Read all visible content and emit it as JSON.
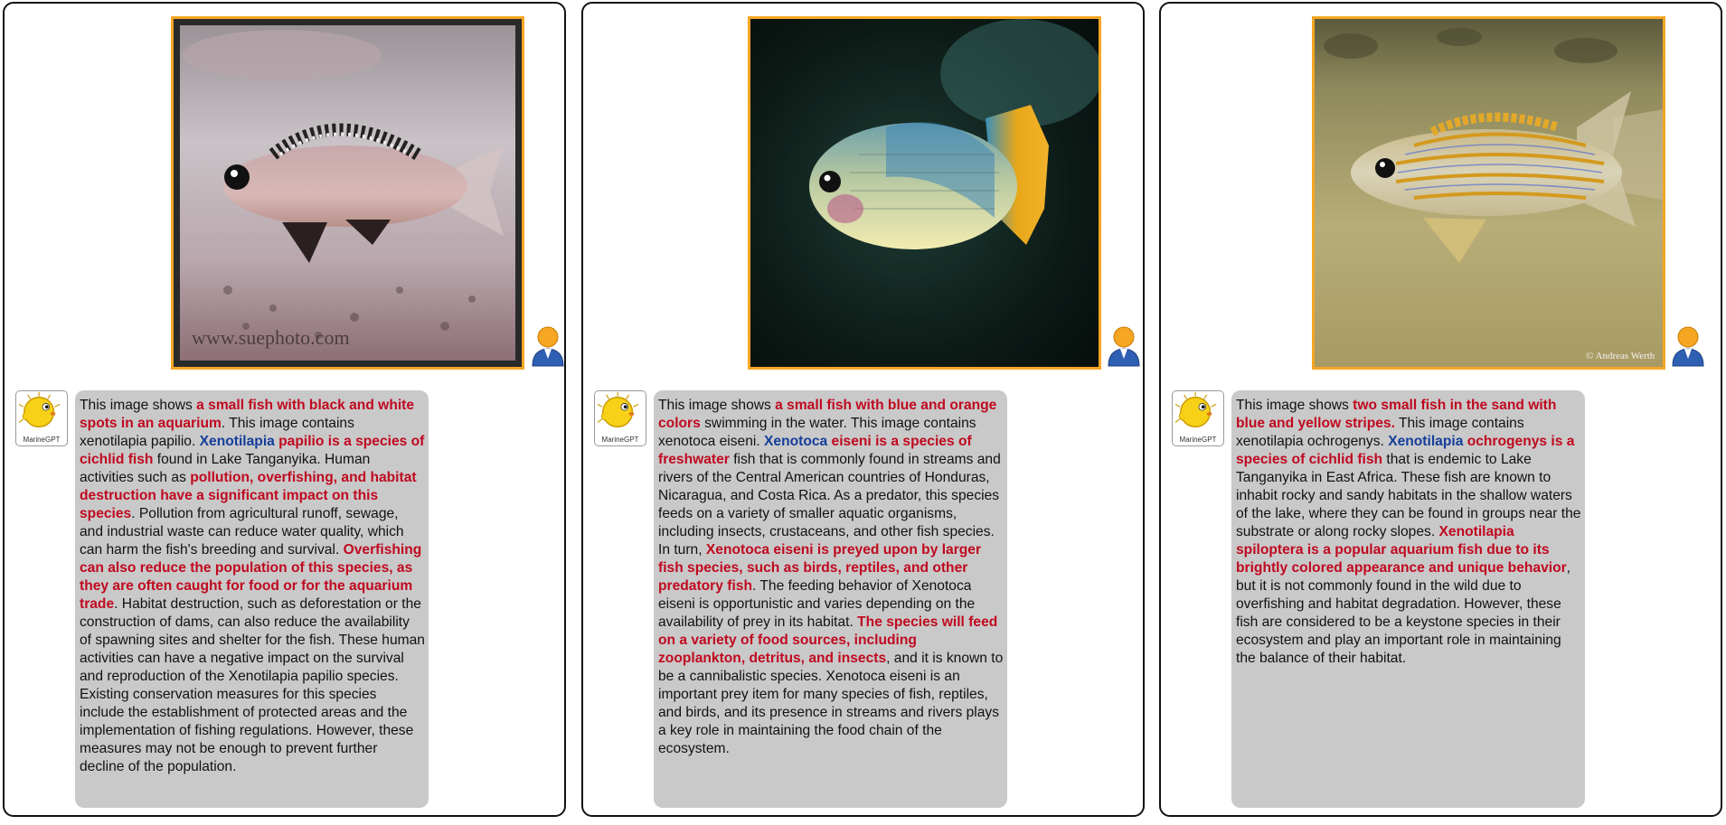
{
  "bot_label": "MarineGPT",
  "colors": {
    "highlight_red": "#c0091f",
    "highlight_blue": "#153e9c",
    "frame_orange": "#f5a623",
    "bubble_gray": "#c9c9c9"
  },
  "panels": [
    {
      "image": {
        "watermark": "www.suephoto.com"
      },
      "segments": [
        {
          "t": "This image shows ",
          "s": "plain"
        },
        {
          "t": "a small fish with black and white spots in an aquarium",
          "s": "red"
        },
        {
          "t": ". This image contains xenotilapia papilio. ",
          "s": "plain"
        },
        {
          "t": "Xenotilapia",
          "s": "blue"
        },
        {
          "t": " papilio is a species of cichlid fish",
          "s": "red"
        },
        {
          "t": " found in Lake Tanganyika. Human activities such as ",
          "s": "plain"
        },
        {
          "t": "pollution, overfishing, and habitat destruction have a significant impact on this species",
          "s": "red"
        },
        {
          "t": ". Pollution from agricultural runoff, sewage, and industrial waste can reduce water quality, which can harm the fish's breeding and survival. ",
          "s": "plain"
        },
        {
          "t": "Overfishing can also reduce the population of this species, as they are often caught for food or for the aquarium trade",
          "s": "red"
        },
        {
          "t": ". Habitat destruction, such as deforestation or the construction of dams, can also reduce the availability of spawning sites and shelter for the fish. These human activities can have a negative impact on the survival and reproduction of the Xenotilapia papilio species. Existing conservation measures for this species include the establishment of protected areas and the implementation of fishing regulations. However, these measures may not be enough to prevent further decline of the population.",
          "s": "plain"
        }
      ]
    },
    {
      "image": {
        "watermark": ""
      },
      "segments": [
        {
          "t": "This image shows ",
          "s": "plain"
        },
        {
          "t": "a small fish with blue and orange colors",
          "s": "red"
        },
        {
          "t": " swimming in the water. This image contains xenotoca eiseni. ",
          "s": "plain"
        },
        {
          "t": "Xenotoca",
          "s": "blue"
        },
        {
          "t": " eiseni is a species of freshwater",
          "s": "red"
        },
        {
          "t": " fish that is commonly found in streams and rivers of the Central American countries of Honduras, Nicaragua, and Costa Rica. As a predator, this species feeds on a variety of smaller aquatic organisms, including insects, crustaceans, and other fish species. In turn, ",
          "s": "plain"
        },
        {
          "t": "Xenotoca eiseni is preyed upon by larger fish species, such as birds, reptiles, and other predatory fish",
          "s": "red"
        },
        {
          "t": ". The feeding behavior of Xenotoca eiseni is opportunistic and varies depending on the availability of prey in its habitat. ",
          "s": "plain"
        },
        {
          "t": "The species will feed on a variety of food sources, including zooplankton, detritus, and insects",
          "s": "red"
        },
        {
          "t": ", and it is known to be a cannibalistic species. Xenotoca eiseni is an important prey item for many species of fish, reptiles, and birds, and its presence in streams and rivers plays a key role in maintaining the food chain of the ecosystem.",
          "s": "plain"
        }
      ]
    },
    {
      "image": {
        "watermark": "© Andreas Werth"
      },
      "segments": [
        {
          "t": "This image shows ",
          "s": "plain"
        },
        {
          "t": "two small fish in the sand with blue and yellow stripes.",
          "s": "red"
        },
        {
          "t": " This image contains xenotilapia ochrogenys. ",
          "s": "plain"
        },
        {
          "t": "Xenotilapia",
          "s": "blue"
        },
        {
          "t": " ochrogenys is a species of cichlid fish",
          "s": "red"
        },
        {
          "t": " that is endemic to Lake Tanganyika in East Africa. These fish are known to inhabit rocky and sandy habitats in the shallow waters of the lake, where they can be found in groups near the substrate or along rocky slopes. ",
          "s": "plain"
        },
        {
          "t": "Xenotilapia spiloptera is a popular aquarium fish due to its brightly colored appearance and unique behavior",
          "s": "red"
        },
        {
          "t": ", but it is not commonly found in the wild due to overfishing and habitat degradation. However, these fish are considered to be a keystone species in their ecosystem and play an important role in maintaining the balance of their habitat.",
          "s": "plain"
        }
      ]
    }
  ]
}
